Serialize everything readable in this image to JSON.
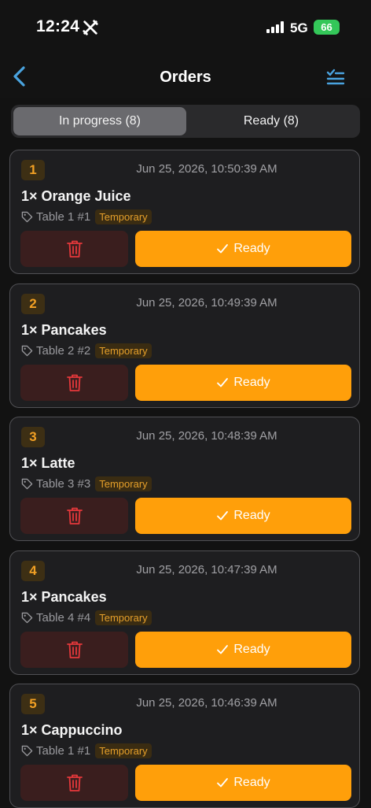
{
  "status_bar": {
    "time": "12:24",
    "network": "5G",
    "battery": "66"
  },
  "nav": {
    "title": "Orders"
  },
  "tabs": [
    {
      "label": "In progress (8)",
      "active": true
    },
    {
      "label": "Ready (8)",
      "active": false
    }
  ],
  "orders": [
    {
      "number": "1",
      "timestamp": "Jun 25, 2026, 10:50:39 AM",
      "item": "1× Orange Juice",
      "table": "Table 1 #1",
      "badge": "Temporary",
      "ready_label": "Ready"
    },
    {
      "number": "2",
      "timestamp": "Jun 25, 2026, 10:49:39 AM",
      "item": "1× Pancakes",
      "table": "Table 2 #2",
      "badge": "Temporary",
      "ready_label": "Ready"
    },
    {
      "number": "3",
      "timestamp": "Jun 25, 2026, 10:48:39 AM",
      "item": "1× Latte",
      "table": "Table 3 #3",
      "badge": "Temporary",
      "ready_label": "Ready"
    },
    {
      "number": "4",
      "timestamp": "Jun 25, 2026, 10:47:39 AM",
      "item": "1× Pancakes",
      "table": "Table 4 #4",
      "badge": "Temporary",
      "ready_label": "Ready"
    },
    {
      "number": "5",
      "timestamp": "Jun 25, 2026, 10:46:39 AM",
      "item": "1× Cappuccino",
      "table": "Table 1 #1",
      "badge": "Temporary",
      "ready_label": "Ready"
    }
  ],
  "colors": {
    "accent": "#ff9f0a",
    "danger": "#e5383b",
    "back": "#4aa3df"
  }
}
